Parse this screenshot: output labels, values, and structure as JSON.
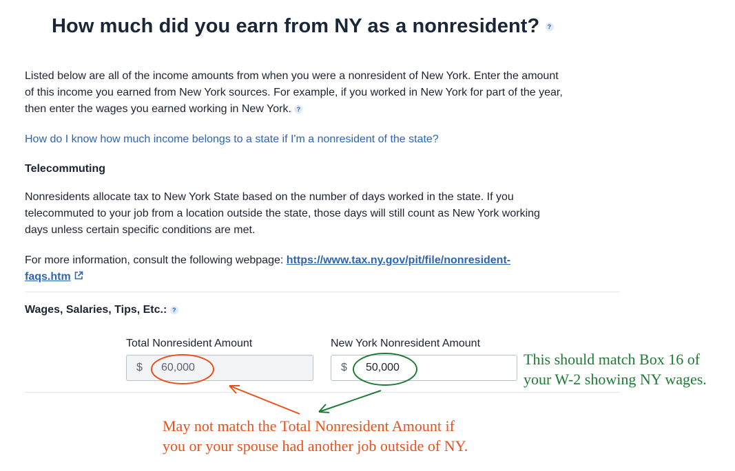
{
  "title": "How much did you earn from NY as a nonresident?",
  "intro_lines": [
    "Listed below are all of the income amounts from when you were a nonresident of New York. Enter the amount",
    "of this income you earned from New York sources. For example, if you worked in New York for part of the year,",
    "then enter the wages you earned working in New York."
  ],
  "help_link": "How do I know how much income belongs to a state if I'm a nonresident of the state?",
  "telecommuting": {
    "heading": "Telecommuting",
    "lines": [
      "Nonresidents allocate tax to New York State based on the number of days worked in the state. If you",
      "telecommuted to your job from a location outside the state, those days will still count as New York working",
      "days unless certain specific conditions are met."
    ],
    "more_info_prefix": "For more information, consult the following webpage:",
    "url_line1": "https://www.tax.ny.gov/pit/file/nonresident-",
    "url_line2": "faqs.htm"
  },
  "wages": {
    "heading": "Wages, Salaries, Tips, Etc.:",
    "total_label": "Total Nonresident Amount",
    "ny_label": "New York Nonresident Amount",
    "currency": "$",
    "total_value": "60,000",
    "ny_value": "50,000"
  },
  "annotations": {
    "green_line1": "This should match Box 16 of",
    "green_line2": "your W-2 showing NY wages.",
    "orange_line1": "May not match the Total Nonresident Amount if",
    "orange_line2": "you or your spouse had another job outside of NY."
  },
  "colors": {
    "link": "#2d64b3",
    "green_annotation": "#1e7a34",
    "orange_annotation": "#e8501c"
  }
}
